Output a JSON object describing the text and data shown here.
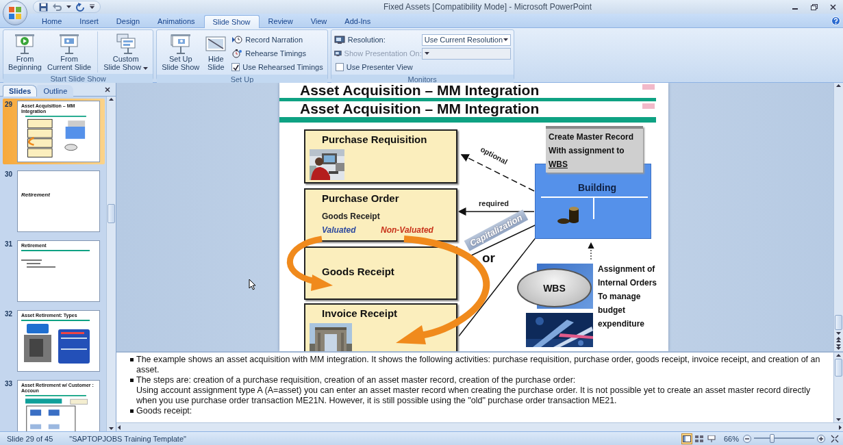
{
  "window": {
    "title": "Fixed Assets [Compatibility Mode] - Microsoft PowerPoint"
  },
  "ribbon_tabs": [
    {
      "label": "Home",
      "selected": false
    },
    {
      "label": "Insert",
      "selected": false
    },
    {
      "label": "Design",
      "selected": false
    },
    {
      "label": "Animations",
      "selected": false
    },
    {
      "label": "Slide Show",
      "selected": true
    },
    {
      "label": "Review",
      "selected": false
    },
    {
      "label": "View",
      "selected": false
    },
    {
      "label": "Add-Ins",
      "selected": false
    }
  ],
  "ribbon_groups": [
    {
      "label": "Start Slide Show",
      "buttons": [
        {
          "kind": "large",
          "lines": [
            "From",
            "Beginning"
          ]
        },
        {
          "kind": "large",
          "lines": [
            "From",
            "Current Slide"
          ]
        },
        {
          "kind": "large_menu",
          "lines": [
            "Custom",
            "Slide Show"
          ]
        }
      ]
    },
    {
      "label": "Set Up",
      "buttons": [
        {
          "kind": "large",
          "lines": [
            "Set Up",
            "Slide Show"
          ]
        },
        {
          "kind": "large",
          "lines": [
            "Hide",
            "Slide"
          ]
        },
        {
          "kind": "small",
          "label": "Record Narration"
        },
        {
          "kind": "small",
          "label": "Rehearse Timings"
        },
        {
          "kind": "check",
          "label": "Use Rehearsed Timings",
          "checked": true
        }
      ]
    },
    {
      "label": "Monitors",
      "buttons": [
        {
          "kind": "select",
          "label": "Resolution:",
          "value": "Use Current Resolution",
          "disabled": false
        },
        {
          "kind": "select",
          "label": "Show Presentation On:",
          "disabled": true
        },
        {
          "kind": "check",
          "label": "Use Presenter View",
          "checked": false
        }
      ]
    }
  ],
  "slide_pane": {
    "tabs": [
      {
        "label": "Slides",
        "selected": true
      },
      {
        "label": "Outline",
        "selected": false
      }
    ],
    "thumbnails": [
      {
        "number": "29",
        "title": "Asset Acquisition – MM Integration",
        "selected": true
      },
      {
        "number": "30",
        "title": "Retirement",
        "selected": false
      },
      {
        "number": "31",
        "title": "Retirement",
        "selected": false
      },
      {
        "number": "32",
        "title": "Asset Retirement: Types",
        "selected": false
      },
      {
        "number": "33",
        "title": "Asset Retirement w/ Customer : Accoun",
        "selected": false
      }
    ]
  },
  "slide": {
    "titles": [
      "Asset Acquisition – MM Integration",
      "Asset Acquisition – MM Integration"
    ],
    "process_boxes": [
      {
        "kind": "picture_box",
        "title": "Purchase Requisition"
      },
      {
        "kind": "status_box",
        "title": "Purchase Order",
        "subtitle": "Goods Receipt",
        "options": [
          {
            "label": "Valuated",
            "color": "#2e4a9e"
          },
          {
            "label": "Non-Valuated",
            "color": "#c8321a"
          }
        ]
      },
      {
        "kind": "plain",
        "title": "Goods Receipt"
      },
      {
        "kind": "picture_box",
        "title": "Invoice Receipt"
      }
    ],
    "master_record": {
      "lines": [
        "Create Master Record",
        "With assignment to"
      ],
      "link": "WBS"
    },
    "asset": {
      "label": "Building"
    },
    "wbs": {
      "label": "WBS"
    },
    "assignment_note": {
      "lines": [
        "Assignment of",
        "Internal Orders",
        "To manage",
        "budget",
        "expenditure"
      ]
    },
    "optional_label": "optional",
    "required_label": "required",
    "capitalization_label": "Capitalization",
    "or_label": "or"
  },
  "notes": [
    {
      "kind": "bullet",
      "text": "The example shows an asset acquisition with MM integration. It shows the following activities: purchase requisition, purchase order, goods receipt, invoice receipt, and creation of an asset."
    },
    {
      "kind": "bullet",
      "text": "The steps are: creation of a purchase requisition, creation of an asset master record, creation of the purchase order:"
    },
    {
      "kind": "continuation",
      "text": "Using account assignment type A (A=asset) you can enter an asset master record when creating the purchase order. It is not possible yet to create an asset master record directly when you use purchase order transaction ME21N.  However, it is still possible using the \"old\" purchase order transaction ME21."
    },
    {
      "kind": "bullet",
      "text": "Goods receipt:"
    }
  ],
  "status_bar": {
    "slide_counter": "Slide 29 of 45",
    "template": "\"SAPTOPJOBS Training Template\"",
    "views": [
      {
        "kind": "normal",
        "selected": true
      },
      {
        "kind": "sorter",
        "selected": false
      },
      {
        "kind": "show",
        "selected": false
      }
    ],
    "zoom": {
      "reading": "66%",
      "level": 0.3
    }
  }
}
